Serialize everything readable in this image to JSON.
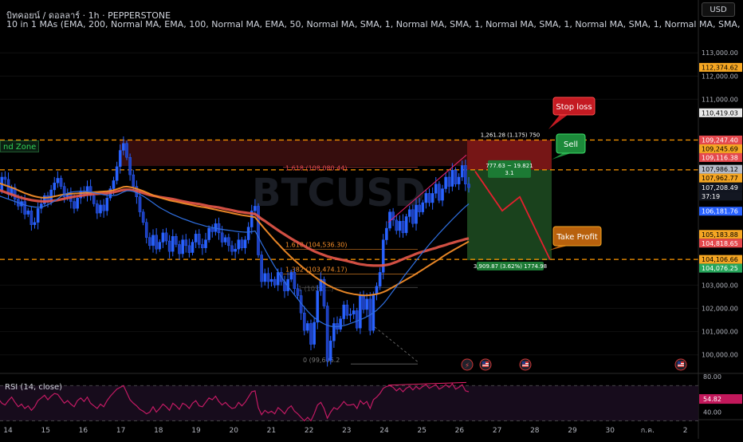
{
  "header": {
    "title": "บิทคอยน์ / ดอลลาร์ · 1h · PEPPERSTONE",
    "indicator": "10 in 1 MAs (EMA, 200, Normal MA, EMA, 100, Normal MA, EMA, 50, Normal MA, SMA, 1, Normal MA, SMA, 1, Normal MA, SMA, 1, Normal MA, SMA, 1, Normal MA, SMA, 1, N"
  },
  "currency_button": "USD",
  "zone_label": "nd Zone",
  "watermark": "BTCUSD",
  "rsi_label": "RSI (14, close)",
  "colors": {
    "background": "#000000",
    "candles": "#2962ff",
    "ema200": "#e8584a",
    "ema100": "#f28c28",
    "ema50": "#2f6fe0",
    "stop_zone": "#8b1a1a",
    "target_zone": "#1e4d22",
    "rsi": "#c21a63",
    "dashed_levels": "#ff9800",
    "trend_line": "#e8236c"
  },
  "icons": [
    "lightning-icon",
    "us-flag-icon",
    "us-flag-icon",
    "us-flag-icon",
    "us-flag-icon"
  ],
  "chart_data": {
    "type": "candlestick",
    "symbol": "BTCUSD",
    "timeframe": "1h",
    "ylim": [
      99200,
      113900
    ],
    "y_ticks": [
      {
        "v": 113000,
        "label": "113,000.00"
      },
      {
        "v": 112000,
        "label": "112,000.00"
      },
      {
        "v": 111000,
        "label": "111,000.00"
      },
      {
        "v": 103000,
        "label": "103,000.00"
      },
      {
        "v": 102000,
        "label": "102,000.00"
      },
      {
        "v": 101000,
        "label": "101,000.00"
      },
      {
        "v": 100000,
        "label": "100,000.00"
      }
    ],
    "price_tags": [
      {
        "v": 112374.62,
        "label": "112,374.62",
        "bg": "#f5a623",
        "fg": "#000000"
      },
      {
        "v": 110419.03,
        "label": "110,419.03",
        "bg": "#e8e8e8",
        "fg": "#000000"
      },
      {
        "v": 109247.4,
        "label": "109,247.40",
        "bg": "#e5484d",
        "fg": "#ffffff"
      },
      {
        "v": 109245.69,
        "label": "109,245.69",
        "bg": "#f5a623",
        "fg": "#000000"
      },
      {
        "v": 109116.38,
        "label": "109,116.38",
        "bg": "#e5484d",
        "fg": "#ffffff"
      },
      {
        "v": 107986.12,
        "label": "107,986.12",
        "bg": "#b7bcc8",
        "fg": "#000000"
      },
      {
        "v": 107962.77,
        "label": "107,962.77",
        "bg": "#f5a623",
        "fg": "#000000"
      },
      {
        "v": 107208.49,
        "label": "107,208.49",
        "bg": "#131722",
        "fg": "#ffffff"
      },
      {
        "v": 106181.76,
        "label": "106,181.76",
        "bg": "#2962ff",
        "fg": "#ffffff"
      },
      {
        "v": 105183.88,
        "label": "105,183.88",
        "bg": "#f5a623",
        "fg": "#000000"
      },
      {
        "v": 104818.65,
        "label": "104,818.65",
        "bg": "#e5484d",
        "fg": "#ffffff"
      },
      {
        "v": 104106.66,
        "label": "104,106.66",
        "bg": "#f5a623",
        "fg": "#000000"
      },
      {
        "v": 104076.25,
        "label": "104,076.25",
        "bg": "#26a65b",
        "fg": "#ffffff"
      }
    ],
    "countdown": "37:19",
    "x_labels": [
      "14",
      "15",
      "16",
      "17",
      "18",
      "19",
      "20",
      "21",
      "22",
      "23",
      "24",
      "25",
      "26",
      "27",
      "28",
      "29",
      "30",
      "ก.ค.",
      "2"
    ],
    "dashed_levels": [
      109245.69,
      107962.77,
      104106.66
    ],
    "fib_labels": [
      {
        "label": "1.618 (104,536.30)",
        "v": 104536.3
      },
      {
        "label": "1.382 (103,474.17)",
        "v": 103474.17
      },
      {
        "label": "0 (99,606.2",
        "v": 99606.2
      },
      {
        "label": "1.618 (108,080.44)",
        "v": 108080.44
      },
      {
        "label": "1 (103,0...)",
        "v": 103000
      }
    ],
    "position": {
      "entry": 107962.77,
      "stop": 109247.4,
      "target": 104076.25,
      "stop_text": "1,261.28 (1.175) 750",
      "rr_text_1": "777.63 ~ 19.821",
      "rr_text_2": "3.1",
      "target_text": "3,909.87 (3.62%) 1774.98"
    },
    "callouts": {
      "stop": "Stop loss",
      "entry": "Sell",
      "target": "Take Profit"
    },
    "series_closes": [
      107300,
      107100,
      107650,
      107550,
      106900,
      107200,
      106700,
      106400,
      106600,
      106050,
      106200,
      105600,
      105700,
      106300,
      106500,
      106850,
      106600,
      107100,
      107400,
      107600,
      107250,
      106800,
      106950,
      106600,
      106300,
      106750,
      107050,
      106900,
      107250,
      106850,
      106500,
      106100,
      106450,
      106200,
      106750,
      107150,
      107500,
      108100,
      108800,
      109100,
      108500,
      107750,
      107250,
      106800,
      106150,
      105700,
      105050,
      104700,
      105150,
      104550,
      104850,
      105250,
      104900,
      104450,
      105100,
      104750,
      104350,
      104950,
      104700,
      104400,
      104850,
      105200,
      104750,
      104600,
      104950,
      105450,
      105300,
      105650,
      105250,
      104850,
      105050,
      104700,
      104450,
      104550,
      104950,
      104600,
      104950,
      105500,
      106200,
      106400,
      104300,
      103150,
      103500,
      103150,
      103250,
      103000,
      103550,
      103150,
      102750,
      103250,
      103550,
      102850,
      102550,
      101800,
      101050,
      101350,
      100450,
      101400,
      102750,
      103250,
      102100,
      99750,
      100600,
      101350,
      101100,
      101550,
      102150,
      101700,
      101750,
      101900,
      101150,
      102550,
      101950,
      102400,
      101050,
      102600,
      102950,
      103550,
      104950,
      105450,
      106150,
      105800,
      105350,
      105750,
      105250,
      105950,
      106250,
      105650,
      106450,
      106150,
      106550,
      106950,
      106550,
      106950,
      107350,
      106650,
      107150,
      107650,
      107250,
      107950,
      107350,
      107650,
      108150,
      107350,
      107200
    ],
    "ema200": [
      107150,
      107100,
      107050,
      107000,
      106950,
      106900,
      106850,
      106800,
      106760,
      106720,
      106690,
      106660,
      106640,
      106620,
      106610,
      106600,
      106610,
      106620,
      106640,
      106660,
      106690,
      106720,
      106750,
      106780,
      106810,
      106830,
      106850,
      106870,
      106890,
      106910,
      106920,
      106930,
      106940,
      106950,
      106960,
      106980,
      107000,
      107030,
      107070,
      107100,
      107110,
      107100,
      107080,
      107050,
      107010,
      106970,
      106920,
      106880,
      106850,
      106820,
      106790,
      106770,
      106750,
      106730,
      106700,
      106670,
      106640,
      106610,
      106580,
      106550,
      106530,
      106510,
      106490,
      106460,
      106430,
      106400,
      106380,
      106360,
      106340,
      106310,
      106280,
      106250,
      106220,
      106190,
      106160,
      106140,
      106120,
      106100,
      106080,
      106060,
      105960,
      105850,
      105760,
      105660,
      105560,
      105460,
      105360,
      105270,
      105180,
      105090,
      105000,
      104920,
      104840,
      104760,
      104680,
      104600,
      104530,
      104460,
      104400,
      104340,
      104290,
      104240,
      104200,
      104160,
      104130,
      104100,
      104070,
      104040,
      104000,
      103970,
      103930,
      103900,
      103880,
      103860,
      103850,
      103840,
      103840,
      103840,
      103850,
      103870,
      103900,
      103950,
      104000,
      104060,
      104120,
      104180,
      104230,
      104290,
      104350,
      104400,
      104440,
      104480,
      104520,
      104560,
      104600,
      104650,
      104690,
      104730,
      104780,
      104820,
      104860,
      104900,
      104940,
      104980,
      105010
    ],
    "ema100": [
      107450,
      107400,
      107350,
      107300,
      107250,
      107200,
      107150,
      107080,
      107020,
      106960,
      106910,
      106860,
      106820,
      106790,
      106770,
      106760,
      106770,
      106790,
      106820,
      106850,
      106880,
      106900,
      106920,
      106930,
      106940,
      106950,
      106960,
      106970,
      106980,
      106990,
      107000,
      107010,
      107020,
      107030,
      107040,
      107060,
      107090,
      107130,
      107180,
      107230,
      107240,
      107220,
      107190,
      107150,
      107100,
      107050,
      106990,
      106930,
      106870,
      106820,
      106770,
      106730,
      106690,
      106650,
      106620,
      106590,
      106560,
      106530,
      106500,
      106470,
      106440,
      106410,
      106380,
      106360,
      106340,
      106310,
      106280,
      106250,
      106220,
      106190,
      106160,
      106130,
      106100,
      106070,
      106040,
      106010,
      105990,
      105970,
      105950,
      105920,
      105750,
      105580,
      105410,
      105250,
      105090,
      104930,
      104780,
      104630,
      104480,
      104340,
      104200,
      104070,
      103950,
      103830,
      103710,
      103600,
      103490,
      103380,
      103280,
      103190,
      103100,
      103010,
      102940,
      102870,
      102810,
      102760,
      102710,
      102670,
      102640,
      102610,
      102590,
      102570,
      102560,
      102560,
      102570,
      102590,
      102610,
      102650,
      102700,
      102760,
      102840,
      102920,
      103000,
      103080,
      103160,
      103240,
      103320,
      103400,
      103490,
      103580,
      103670,
      103760,
      103850,
      103940,
      104030,
      104120,
      104220,
      104310,
      104400,
      104480,
      104560,
      104640,
      104720,
      104800,
      104880
    ],
    "ema50": [
      106900,
      106850,
      106800,
      106750,
      106700,
      106650,
      106600,
      106550,
      106500,
      106450,
      106410,
      106380,
      106360,
      106350,
      106360,
      106400,
      106460,
      106530,
      106620,
      106720,
      106820,
      106900,
      106960,
      107000,
      107020,
      107030,
      107040,
      107040,
      107030,
      107010,
      106980,
      106950,
      106920,
      106890,
      106870,
      106860,
      106860,
      106880,
      106940,
      107010,
      107060,
      107060,
      107030,
      106980,
      106910,
      106830,
      106740,
      106640,
      106540,
      106440,
      106340,
      106260,
      106190,
      106110,
      106040,
      105980,
      105920,
      105860,
      105810,
      105760,
      105710,
      105660,
      105620,
      105580,
      105540,
      105510,
      105480,
      105450,
      105420,
      105400,
      105380,
      105360,
      105340,
      105320,
      105300,
      105290,
      105280,
      105280,
      105300,
      105330,
      105080,
      104800,
      104540,
      104280,
      104040,
      103800,
      103580,
      103360,
      103140,
      102940,
      102760,
      102580,
      102400,
      102220,
      102040,
      101880,
      101730,
      101600,
      101500,
      101410,
      101330,
      101270,
      101230,
      101210,
      101210,
      101230,
      101260,
      101300,
      101350,
      101400,
      101450,
      101510,
      101570,
      101640,
      101720,
      101810,
      101920,
      102050,
      102200,
      102370,
      102560,
      102750,
      102940,
      103130,
      103320,
      103510,
      103690,
      103870,
      104050,
      104230,
      104410,
      104580,
      104750,
      104910,
      105070,
      105230,
      105380,
      105530,
      105680,
      105830,
      105970,
      106110,
      106250,
      106380,
      106500
    ],
    "rsi": {
      "ylim": [
        35,
        82
      ],
      "ticks": [
        80,
        40
      ],
      "bands": [
        70,
        30
      ],
      "current": 54.82,
      "current_label": "54.82",
      "values": [
        52,
        55,
        50,
        48,
        53,
        57,
        51,
        46,
        49,
        44,
        47,
        42,
        46,
        53,
        56,
        59,
        54,
        58,
        61,
        60,
        55,
        50,
        53,
        49,
        46,
        53,
        56,
        52,
        57,
        50,
        47,
        44,
        49,
        46,
        53,
        58,
        62,
        66,
        68,
        70,
        62,
        54,
        50,
        47,
        43,
        41,
        38,
        40,
        46,
        40,
        44,
        49,
        46,
        42,
        50,
        47,
        43,
        50,
        48,
        44,
        50,
        53,
        47,
        46,
        51,
        56,
        54,
        58,
        52,
        48,
        51,
        47,
        44,
        45,
        51,
        47,
        51,
        57,
        63,
        64,
        45,
        37,
        42,
        39,
        41,
        38,
        45,
        42,
        38,
        44,
        47,
        41,
        38,
        34,
        30,
        34,
        30,
        38,
        48,
        51,
        44,
        33,
        40,
        45,
        43,
        47,
        52,
        48,
        48,
        49,
        44,
        53,
        49,
        52,
        44,
        54,
        57,
        61,
        67,
        69,
        70,
        68,
        64,
        67,
        63,
        67,
        69,
        65,
        69,
        66,
        69,
        71,
        67,
        69,
        71,
        66,
        68,
        71,
        68,
        72,
        66,
        68,
        71,
        64,
        63
      ]
    }
  }
}
